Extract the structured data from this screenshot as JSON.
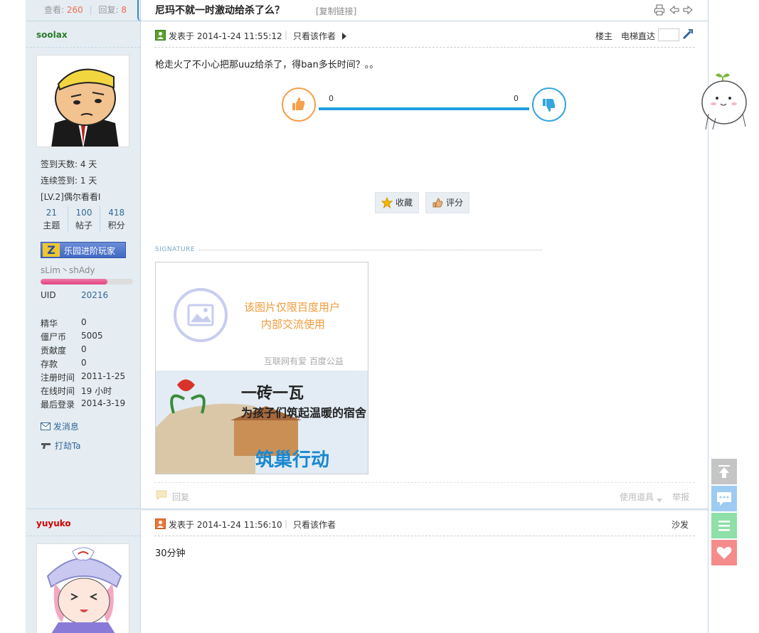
{
  "thread": {
    "views_label": "查看:",
    "views": "260",
    "replies_label": "回复:",
    "replies": "8",
    "title": "尼玛不就一时激动给杀了么？",
    "copy_link": "[复制链接]"
  },
  "post1": {
    "author": "soolax",
    "posted": "发表于 2014-1-24 11:55:12",
    "only_author": "只看该作者",
    "floor": "楼主",
    "elevator": "电梯直达",
    "message": "枪走火了不小心把那uuz给杀了，得ban多长时间？。。",
    "vote_up": "0",
    "vote_down": "0",
    "favorite": "收藏",
    "rate": "评分",
    "signature_label": "SIGNATURE",
    "reply": "回复",
    "use_item": "使用道具",
    "report": "举报",
    "sig_text1": "该图片仅限百度用户",
    "sig_text2": "内部交流使用",
    "sig_text3": "互联网有爱  百度公益",
    "sig_text4": "一砖一瓦",
    "sig_text5": "为孩子们筑起温暖的宿舍",
    "sig_text6": "筑巢行动"
  },
  "profile1": {
    "checkin_days": "签到天数: 4 天",
    "streak": "连续签到: 1 天",
    "level": "[LV.2]偶尔看看I",
    "topics": "21",
    "topics_label": "主题",
    "posts": "100",
    "posts_label": "帖子",
    "points": "418",
    "points_label": "积分",
    "medal": "乐园进阶玩家",
    "tagline": "sLim丶shAdy",
    "progress": 0.72,
    "uid_label": "UID",
    "uid": "20216",
    "fields": [
      {
        "k": "精华",
        "v": "0"
      },
      {
        "k": "僵尸币",
        "v": "5005"
      },
      {
        "k": "贡献度",
        "v": "0"
      },
      {
        "k": "存款",
        "v": "0"
      },
      {
        "k": "注册时间",
        "v": "2011-1-25"
      },
      {
        "k": "在线时间",
        "v": "19 小时"
      },
      {
        "k": "最后登录",
        "v": "2014-3-19"
      }
    ],
    "send_msg": "发消息",
    "hit": "打劫Ta"
  },
  "post2": {
    "author": "yuyuko",
    "posted": "发表于 2014-1-24 11:56:10",
    "only_author": "只看该作者",
    "floor": "沙发",
    "message": "30分钟"
  },
  "colors": {
    "accent": "#369",
    "vote_up": "#f5a04a",
    "vote_down": "#36a6e0"
  }
}
